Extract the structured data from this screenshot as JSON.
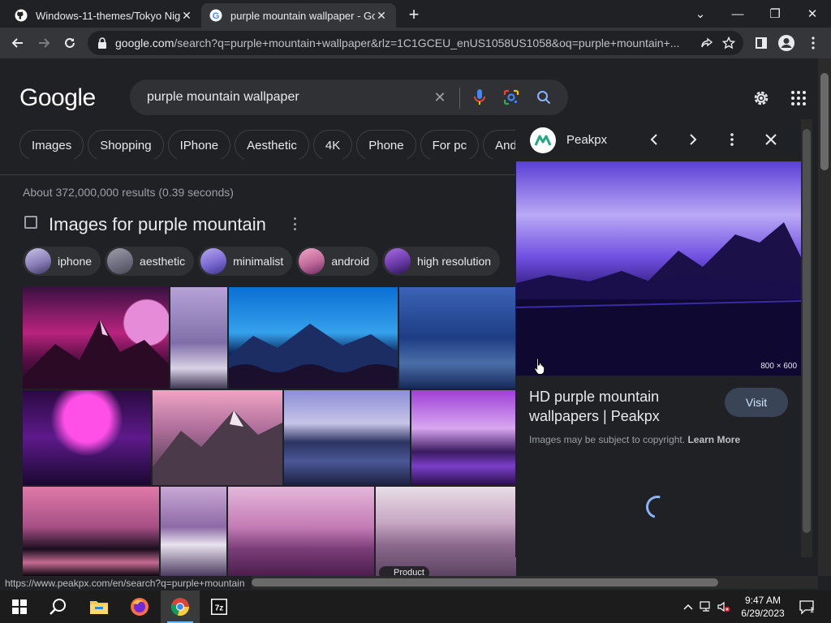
{
  "browser": {
    "tabs": [
      {
        "title": "Windows-11-themes/Tokyo Nigh",
        "close": "✕"
      },
      {
        "title": "purple mountain wallpaper - Goo",
        "close": "✕"
      }
    ],
    "new_tab": "+",
    "window_controls": {
      "tab_search": "⌄",
      "minimize": "—",
      "restore": "❐",
      "close": "✕"
    },
    "url_host": "google.com",
    "url_rest": "/search?q=purple+mountain+wallpaper&rlz=1C1GCEU_enUS1058US1058&oq=purple+mountain+..."
  },
  "search": {
    "logo": "Google",
    "query": "purple mountain wallpaper",
    "clear": "✕"
  },
  "chips": [
    "Images",
    "Shopping",
    "IPhone",
    "Aesthetic",
    "4K",
    "Phone",
    "For pc",
    "Androi"
  ],
  "results": {
    "stats": "About 372,000,000 results (0.39 seconds)",
    "images_title": "Images for purple mountain"
  },
  "subchips": [
    {
      "label": "iphone",
      "color": "#8a7fb8"
    },
    {
      "label": "aesthetic",
      "color": "#7a7a8a"
    },
    {
      "label": "minimalist",
      "color": "#7b6bd1"
    },
    {
      "label": "android",
      "color": "#c06a9a"
    },
    {
      "label": "high resolution",
      "color": "#6b3aa8"
    }
  ],
  "grid_badge": "Product",
  "panel": {
    "site_name": "Peakpx",
    "dimensions": "800 × 600",
    "title": "HD purple mountain wallpapers | Peakpx",
    "visit": "Visit",
    "copyright_text": "Images may be subject to copyright.",
    "learn_more": "Learn More"
  },
  "status_url": "https://www.peakpx.com/en/search?q=purple+mountain",
  "taskbar": {
    "time": "9:47 AM",
    "date": "6/29/2023",
    "notifications": "1"
  },
  "colors": {
    "background": "#202124",
    "accent": "#8ab4f8",
    "visit_button": "#394457"
  }
}
